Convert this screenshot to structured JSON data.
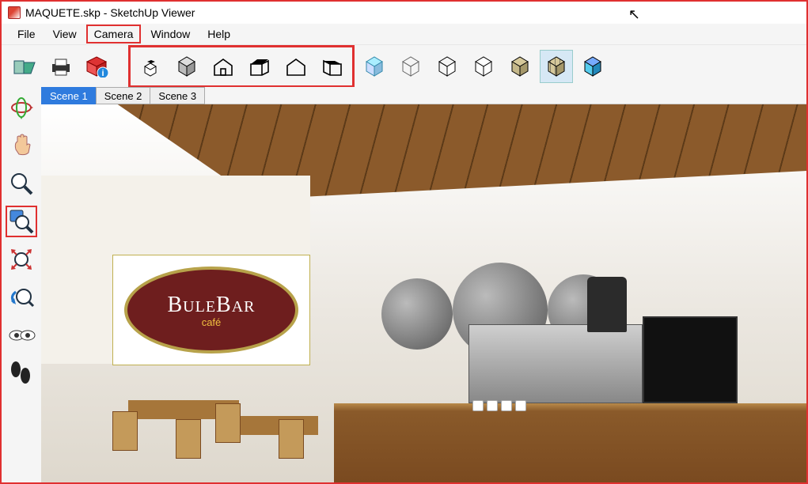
{
  "window": {
    "title": "MAQUETE.skp - SketchUp Viewer"
  },
  "menu": {
    "file": "File",
    "view": "View",
    "camera": "Camera",
    "window": "Window",
    "help": "Help"
  },
  "toolbar": {
    "open": "open-file",
    "print": "print",
    "model_info": "model-info",
    "views": {
      "iso": "iso-view",
      "top": "top-view",
      "front": "front-view",
      "right": "right-view",
      "back": "back-view",
      "left": "left-view"
    },
    "styles": {
      "wireframe": "wireframe",
      "hidden": "hidden-line",
      "xray": "xray",
      "shaded_no": "shaded-no-texture",
      "shaded": "shaded",
      "textures": "shaded-with-textures",
      "mono": "monochrome"
    }
  },
  "scenes": {
    "items": [
      {
        "label": "Scene 1",
        "active": true
      },
      {
        "label": "Scene 2",
        "active": false
      },
      {
        "label": "Scene 3",
        "active": false
      }
    ]
  },
  "side_tools": {
    "orbit": "orbit",
    "pan": "pan",
    "zoom": "zoom",
    "zoom_window": "zoom-window",
    "zoom_extents": "zoom-extents",
    "prev": "previous-view",
    "look": "look-around",
    "walk": "walk"
  },
  "scene_logo": {
    "brand": "BuleBar",
    "sub": "café"
  },
  "highlights": {
    "menu_item": "camera",
    "toolbar_group": "views",
    "side_tool": "zoom_window"
  }
}
